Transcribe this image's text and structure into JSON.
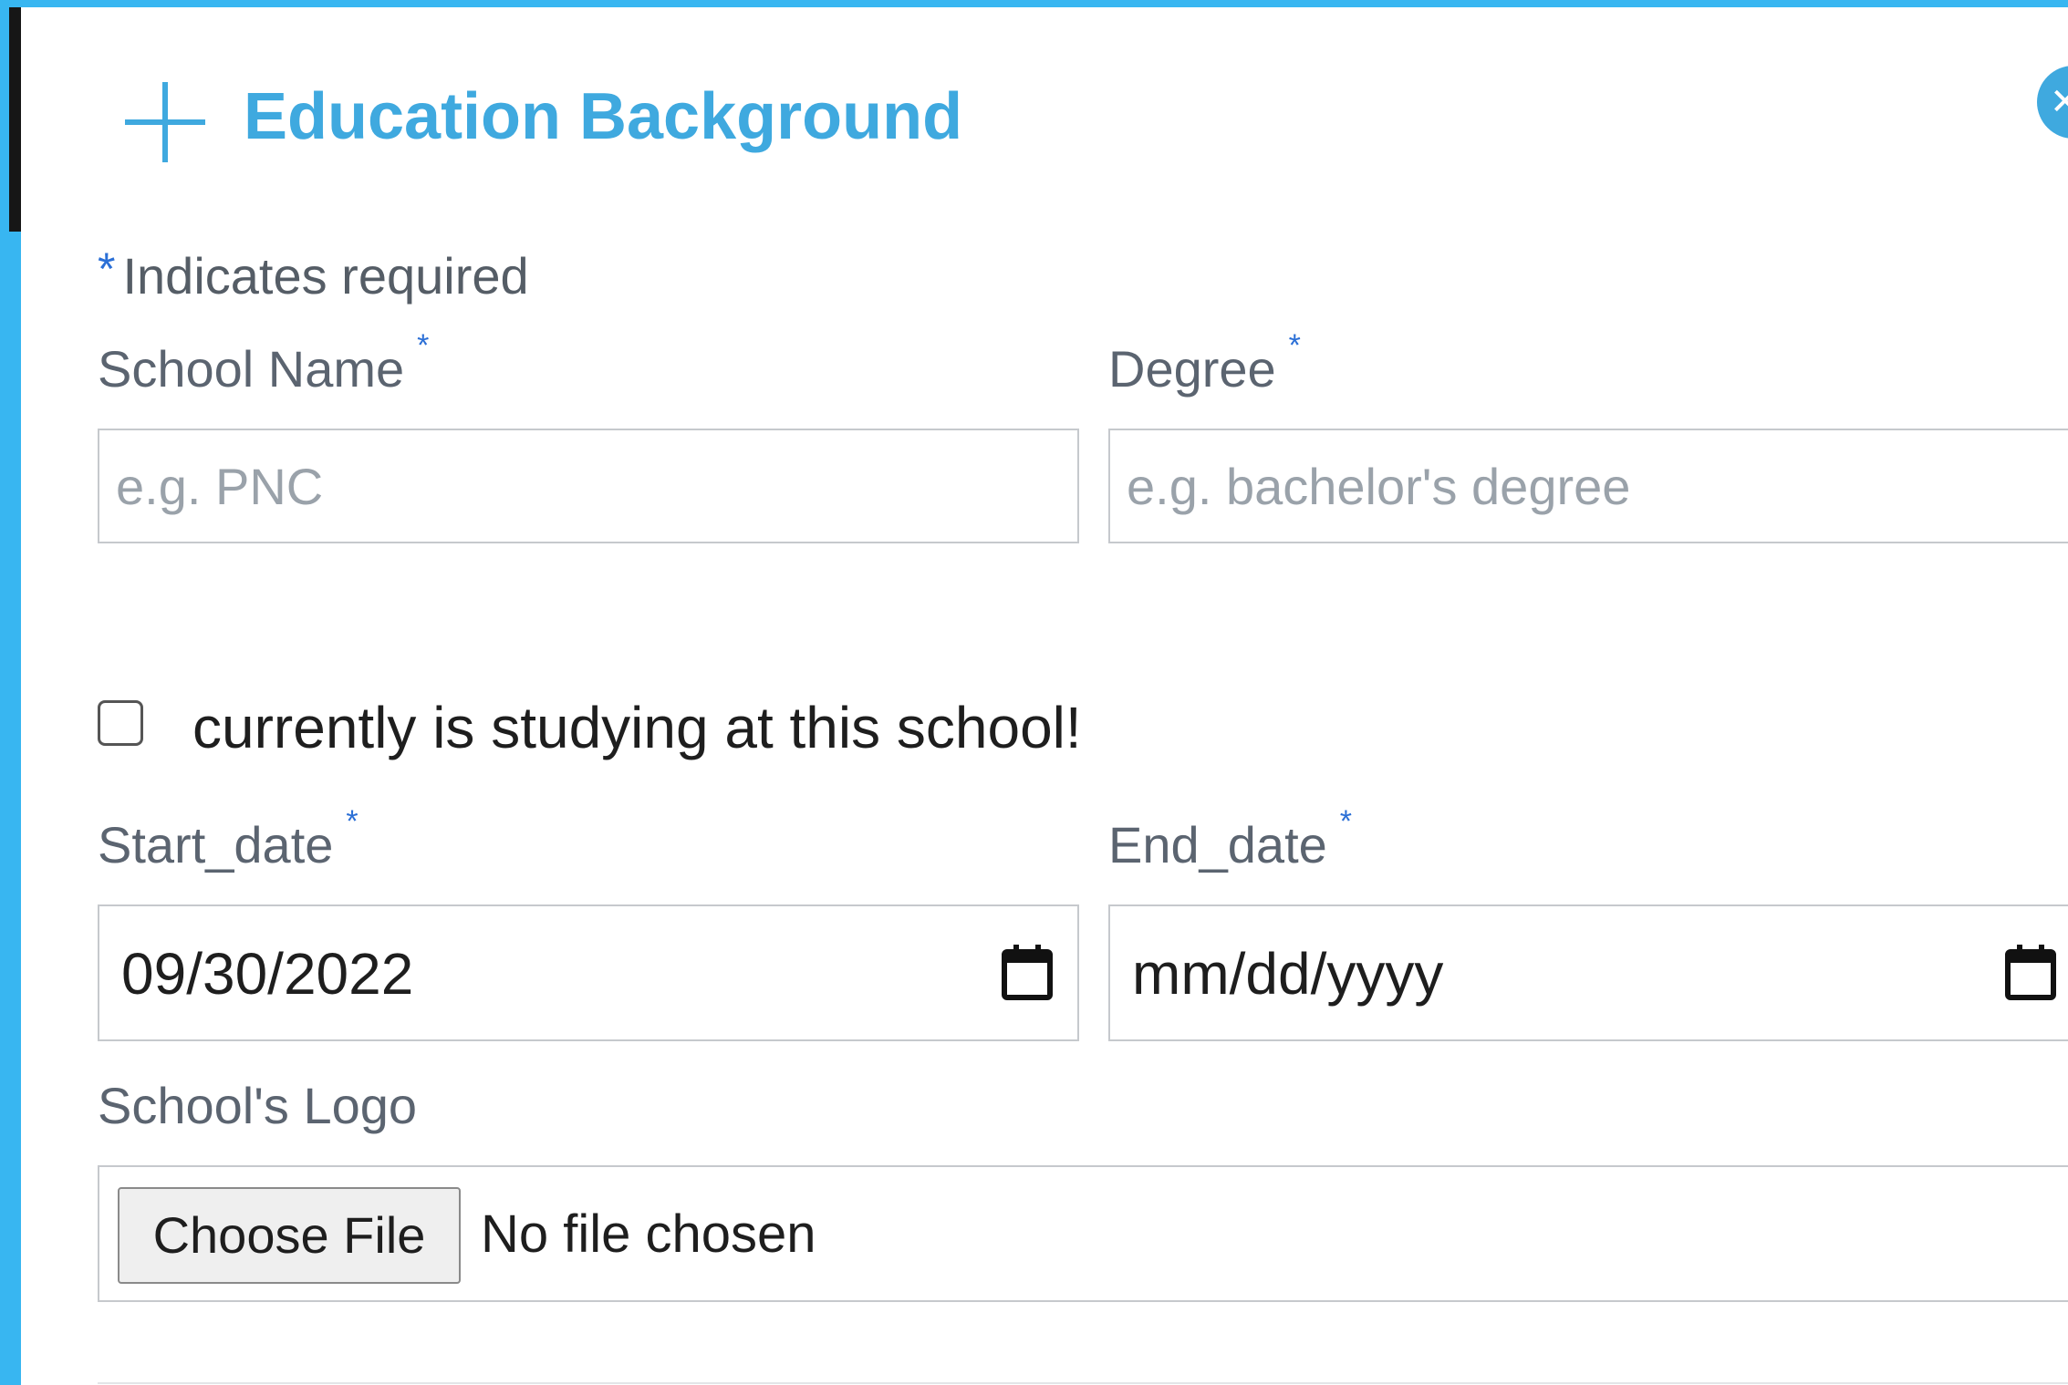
{
  "dialog": {
    "title": "Education Background",
    "close_icon": "close-icon",
    "add_icon": "plus-icon"
  },
  "required_note": {
    "star": "*",
    "text": "Indicates required"
  },
  "fields": {
    "school_name": {
      "label": "School Name",
      "required_mark": "*",
      "placeholder": "e.g. PNC",
      "value": ""
    },
    "degree": {
      "label": "Degree",
      "required_mark": "*",
      "placeholder": "e.g. bachelor's degree",
      "value": ""
    },
    "currently_studying": {
      "label": "currently is studying at this school!",
      "checked": false
    },
    "start_date": {
      "label": "Start_date",
      "required_mark": "*",
      "value": "09/30/2022"
    },
    "end_date": {
      "label": "End_date",
      "required_mark": "*",
      "value": "mm/dd/yyyy"
    },
    "school_logo": {
      "label": "School's Logo",
      "button_label": "Choose File",
      "status": "No file chosen"
    }
  },
  "colors": {
    "accent": "#3fa9df",
    "frame": "#38b6f1",
    "required": "#2b6fd6"
  }
}
